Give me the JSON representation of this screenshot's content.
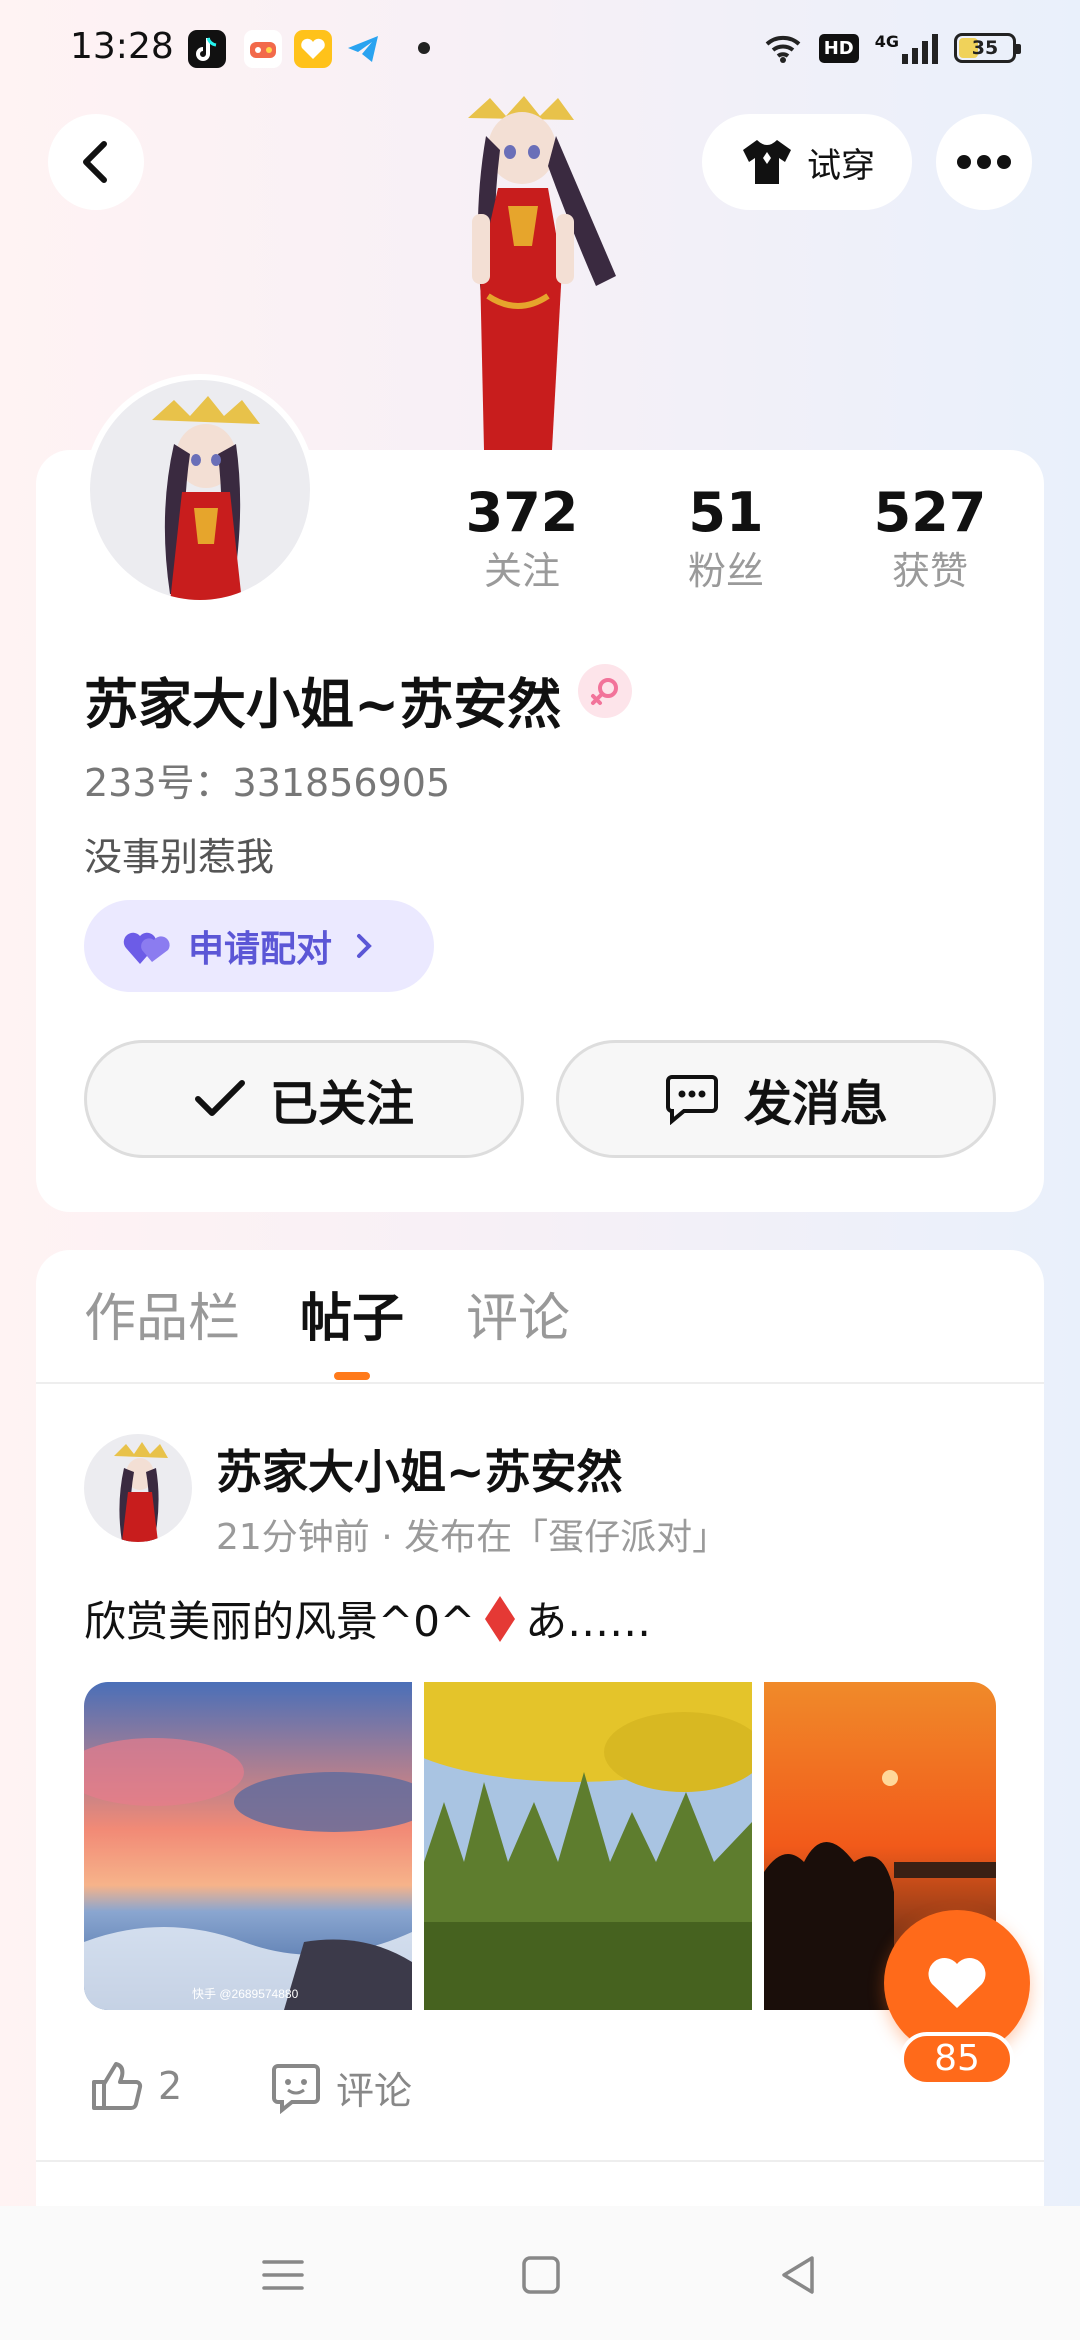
{
  "status_bar": {
    "time": "13:28",
    "network": "4G",
    "hd": "HD",
    "battery_level": "35",
    "battery_percent": 35,
    "app_icons": [
      "tiktok-icon",
      "game-icon",
      "heart-app-icon",
      "telegram-icon"
    ]
  },
  "header": {
    "back_icon": "chevron-left-icon",
    "try_on_label": "试穿",
    "more_icon": "more-dots-icon"
  },
  "profile": {
    "stats": [
      {
        "value": "372",
        "label": "关注"
      },
      {
        "value": "51",
        "label": "粉丝"
      },
      {
        "value": "527",
        "label": "获赞"
      }
    ],
    "name": "苏家大小姐~苏安然",
    "gender": "female-icon",
    "id_text": "233号：331856905",
    "bio": "没事别惹我",
    "match_label": "申请配对",
    "follow_label": "已关注",
    "message_label": "发消息"
  },
  "tabs": [
    {
      "label": "作品栏",
      "active": false
    },
    {
      "label": "帖子",
      "active": true
    },
    {
      "label": "评论",
      "active": false
    }
  ],
  "post": {
    "author": "苏家大小姐~苏安然",
    "meta": "21分钟前 · 发布在「蛋仔派对」",
    "text": "欣赏美丽的风景^0^",
    "text_suffix": "あ……",
    "image_watermark": "快手 @2689574880",
    "likes": "2",
    "comment_label": "评论"
  },
  "floating_like": {
    "count": "85"
  },
  "colors": {
    "accent": "#ff6a1a",
    "match_bg": "#ebe9ff",
    "match_text": "#5b56d6",
    "gender_pink": "#f2739a"
  }
}
